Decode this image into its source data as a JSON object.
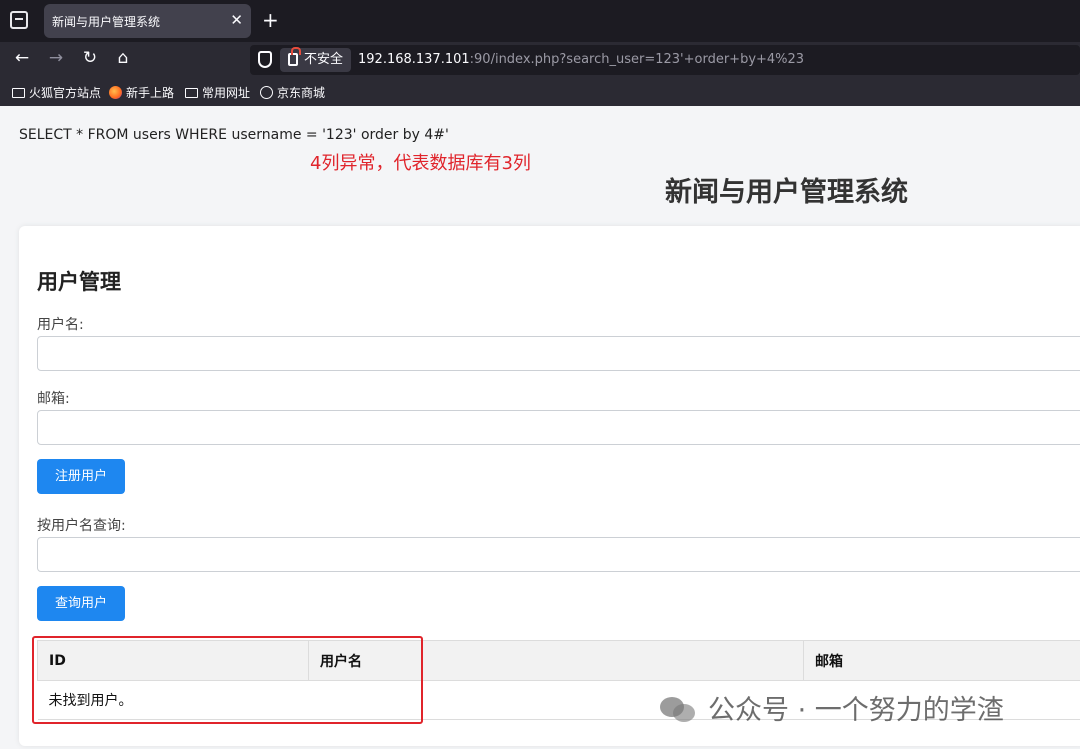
{
  "browser": {
    "tab_title": "新闻与用户管理系统",
    "tab_close": "✕",
    "new_tab": "+",
    "security_label": "不安全",
    "url_host": "192.168.137.101",
    "url_rest": ":90/index.php?search_user=123'+order+by+4%23",
    "nav": {
      "back": "←",
      "forward": "→",
      "reload": "↻",
      "home": "⌂"
    },
    "bookmarks": [
      "火狐官方站点",
      "新手上路",
      "常用网址",
      "京东商城"
    ]
  },
  "page": {
    "sql_query": "SELECT * FROM users WHERE username = '123' order by 4#'",
    "annotation": "4列异常，代表数据库有3列",
    "site_title": "新闻与用户管理系统",
    "section_title": "用户管理",
    "username_label": "用户名:",
    "email_label": "邮箱:",
    "register_button": "注册用户",
    "search_label": "按用户名查询:",
    "search_button": "查询用户",
    "table": {
      "headers": [
        "ID",
        "用户名",
        "邮箱"
      ],
      "empty_message": "未找到用户。"
    }
  },
  "watermark": "公众号 · 一个努力的学渣",
  "colors": {
    "accent": "#1e87f0",
    "annotation": "#e0242b"
  }
}
